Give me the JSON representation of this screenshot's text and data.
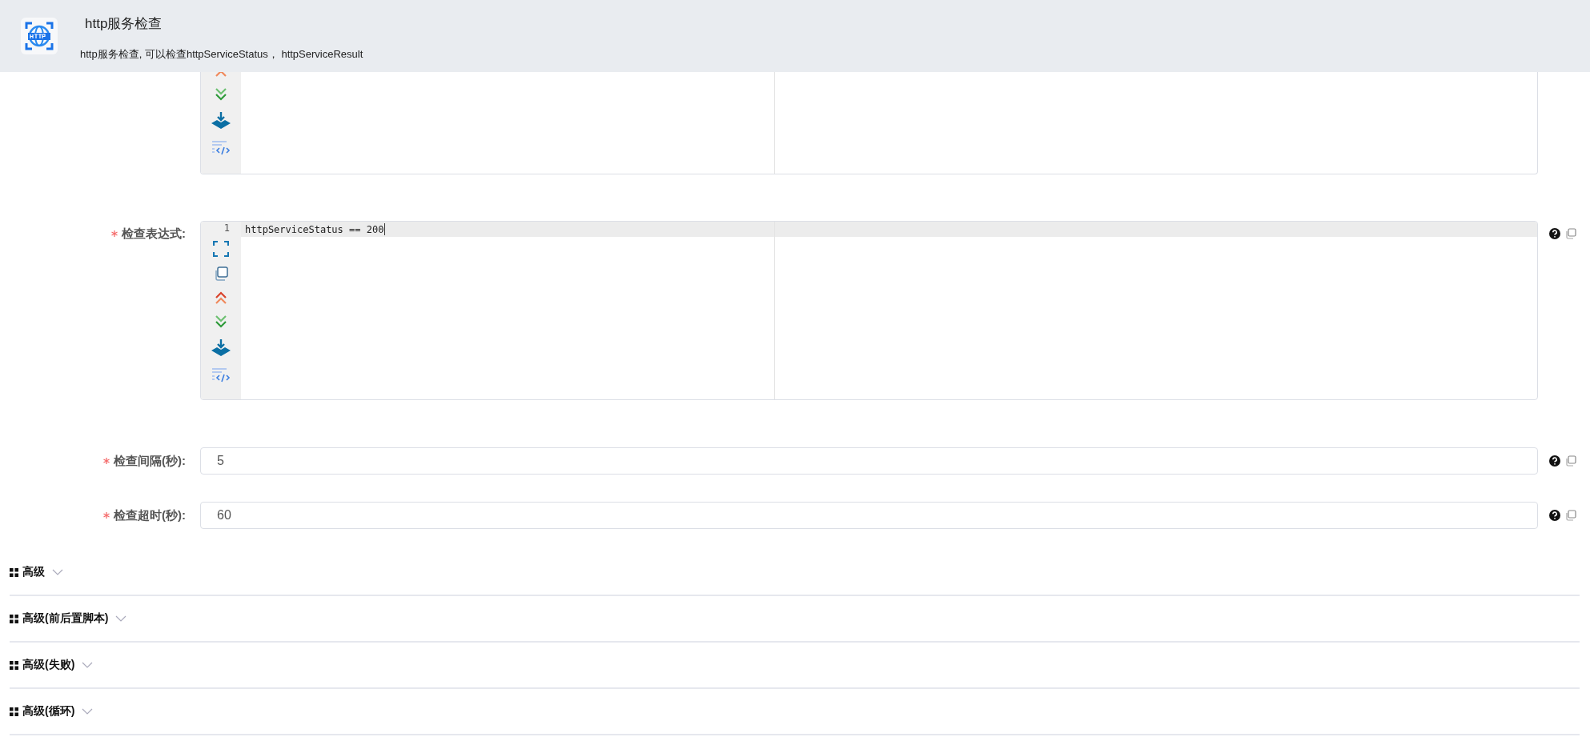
{
  "header": {
    "title": "http服务检查",
    "description": "http服务检查, 可以检查httpServiceStatus， httpServiceResult"
  },
  "form": {
    "rows": [
      {
        "kind": "editor_partial"
      },
      {
        "kind": "editor",
        "label": "检查表达式:",
        "required": true,
        "line_number": "1",
        "code": "httpServiceStatus == 200"
      },
      {
        "kind": "input",
        "label": "检查间隔(秒):",
        "required": true,
        "value": "5"
      },
      {
        "kind": "input",
        "label": "检查超时(秒):",
        "required": true,
        "value": "60"
      }
    ]
  },
  "sections": [
    {
      "label": "高级",
      "expanded": false
    },
    {
      "label": "高级(前后置脚本)",
      "expanded": false
    },
    {
      "label": "高级(失败)",
      "expanded": false
    },
    {
      "label": "高级(循环)",
      "expanded": false
    }
  ]
}
